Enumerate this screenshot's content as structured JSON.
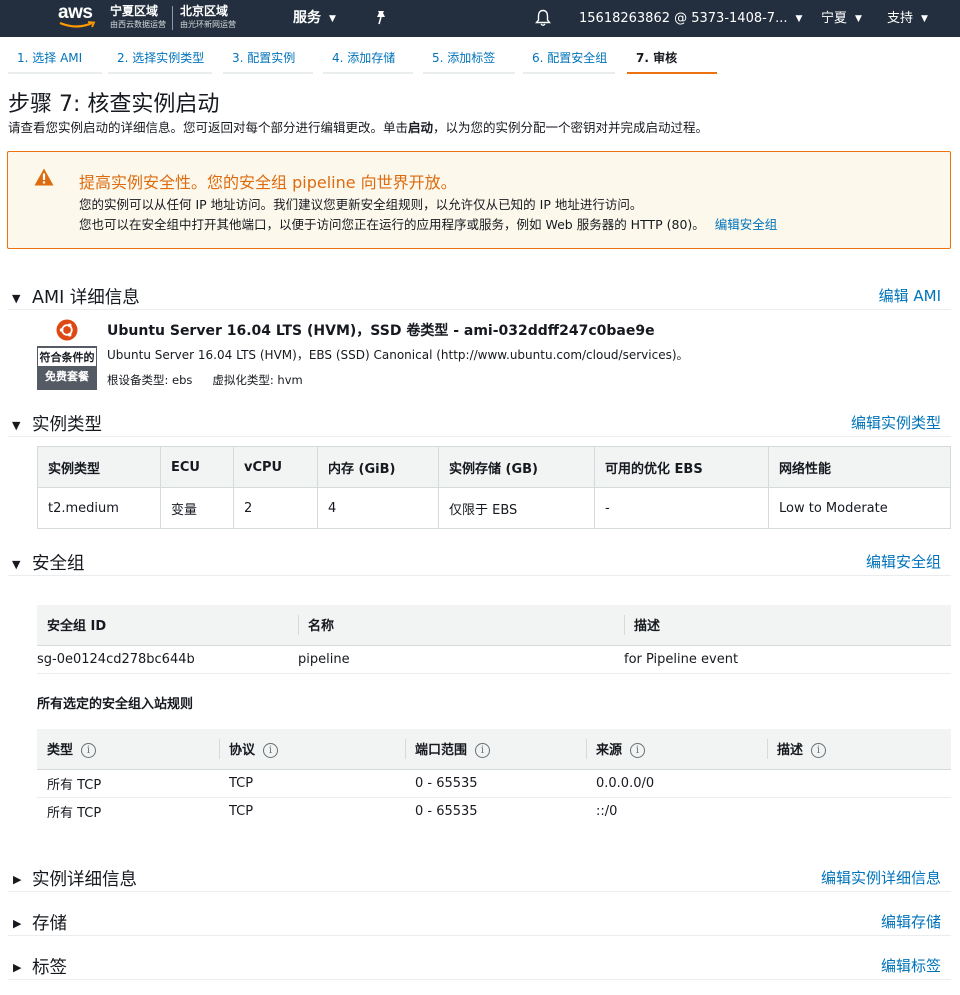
{
  "nav": {
    "logo": "aws",
    "region1": {
      "name": "宁夏区域",
      "operator": "由西云数据运营"
    },
    "region2": {
      "name": "北京区域",
      "operator": "由光环新网运营"
    },
    "services": "服务",
    "account": "15618263862 @ 5373-1408-7...",
    "region_select": "宁夏",
    "support": "支持",
    "icons": [
      "caret-down-icon",
      "pin-icon",
      "bell-icon"
    ]
  },
  "steps": [
    {
      "label": "1. 选择 AMI"
    },
    {
      "label": "2. 选择实例类型"
    },
    {
      "label": "3. 配置实例"
    },
    {
      "label": "4. 添加存储"
    },
    {
      "label": "5. 添加标签"
    },
    {
      "label": "6. 配置安全组"
    },
    {
      "label": "7. 审核"
    }
  ],
  "page": {
    "title": "步骤 7: 核查实例启动",
    "desc_before": "请查看您实例启动的详细信息。您可返回对每个部分进行编辑更改。单击",
    "desc_bold": "启动",
    "desc_after": "，以为您的实例分配一个密钥对并完成启动过程。"
  },
  "warning": {
    "title": "提高实例安全性。您的安全组 pipeline 向世界开放。",
    "line1": "您的实例可以从任何 IP 地址访问。我们建议您更新安全组规则，以允许仅从已知的 IP 地址进行访问。",
    "line2": "您也可以在安全组中打开其他端口，以便于访问您正在运行的应用程序或服务，例如 Web 服务器的 HTTP (80)。",
    "link": "编辑安全组",
    "color": "#dd6b10"
  },
  "ami": {
    "heading": "AMI 详细信息",
    "edit": "编辑 AMI",
    "name": "Ubuntu Server 16.04 LTS (HVM)，SSD 卷类型 - ami-032ddff247c0bae9e",
    "description": "Ubuntu Server 16.04 LTS (HVM)，EBS (SSD) Canonical (http://www.ubuntu.com/cloud/services)。",
    "root_device": "根设备类型: ebs",
    "virtualization": "虚拟化类型: hvm",
    "badge_line1": "符合条件的",
    "badge_line2": "免费套餐"
  },
  "instance": {
    "heading": "实例类型",
    "edit": "编辑实例类型",
    "headers": [
      "实例类型",
      "ECU",
      "vCPU",
      "内存 (GiB)",
      "实例存储 (GB)",
      "可用的优化 EBS",
      "网络性能"
    ],
    "row": [
      "t2.medium",
      "变量",
      "2",
      "4",
      "仅限于 EBS",
      "-",
      "Low to Moderate"
    ]
  },
  "security": {
    "heading": "安全组",
    "edit": "编辑安全组",
    "headers": [
      "安全组 ID",
      "名称",
      "描述"
    ],
    "row": [
      "sg-0e0124cd278bc644b",
      "pipeline",
      "for Pipeline event"
    ],
    "rules_title": "所有选定的安全组入站规则",
    "rule_headers": [
      "类型",
      "协议",
      "端口范围",
      "来源",
      "描述"
    ],
    "rules": [
      [
        "所有 TCP",
        "TCP",
        "0 - 65535",
        "0.0.0.0/0",
        ""
      ],
      [
        "所有 TCP",
        "TCP",
        "0 - 65535",
        "::/0",
        ""
      ]
    ]
  },
  "collapsed": [
    {
      "heading": "实例详细信息",
      "edit": "编辑实例详细信息"
    },
    {
      "heading": "存储",
      "edit": "编辑存储"
    },
    {
      "heading": "标签",
      "edit": "编辑标签"
    }
  ]
}
